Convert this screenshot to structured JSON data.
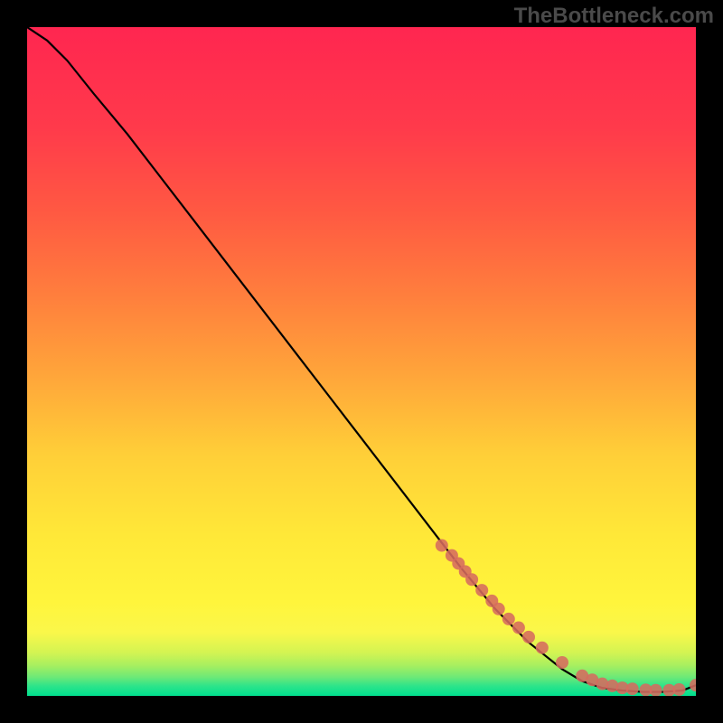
{
  "watermark": "TheBottleneck.com",
  "chart_data": {
    "type": "line",
    "title": "",
    "xlabel": "",
    "ylabel": "",
    "xlim": [
      0,
      100
    ],
    "ylim": [
      0,
      100
    ],
    "gradient_bands": [
      {
        "y_from": 0,
        "y_to": 2,
        "color": "#00e676"
      },
      {
        "y_from": 2,
        "y_to": 3.5,
        "color": "#4de686"
      },
      {
        "y_from": 3.5,
        "y_to": 5,
        "color": "#8bed6e"
      },
      {
        "y_from": 5,
        "y_to": 7,
        "color": "#c5f25a"
      },
      {
        "y_from": 7,
        "y_to": 12,
        "color": "#f5f542"
      },
      {
        "y_from": 12,
        "y_to": 25,
        "color": "#ffe838"
      },
      {
        "y_from": 25,
        "y_to": 40,
        "color": "#ffc93c"
      },
      {
        "y_from": 40,
        "y_to": 55,
        "color": "#ffa23c"
      },
      {
        "y_from": 55,
        "y_to": 70,
        "color": "#ff7b3c"
      },
      {
        "y_from": 70,
        "y_to": 85,
        "color": "#ff553f"
      },
      {
        "y_from": 85,
        "y_to": 100,
        "color": "#ff2e4d"
      }
    ],
    "series": [
      {
        "name": "curve",
        "type": "line",
        "color": "#000000",
        "x": [
          0,
          3,
          6,
          10,
          15,
          20,
          25,
          30,
          35,
          40,
          45,
          50,
          55,
          60,
          65,
          70,
          75,
          80,
          83,
          86,
          89,
          92,
          95,
          98,
          100
        ],
        "y": [
          100,
          98,
          95,
          90,
          84,
          77.5,
          71,
          64.5,
          58,
          51.5,
          45,
          38.5,
          32,
          25.5,
          19,
          13,
          8,
          4,
          2.2,
          1.2,
          0.8,
          0.6,
          0.6,
          0.8,
          1.6
        ]
      },
      {
        "name": "dots",
        "type": "scatter",
        "color": "#d66b5f",
        "x": [
          62,
          63.5,
          64.5,
          65.5,
          66.5,
          68,
          69.5,
          70.5,
          72,
          73.5,
          75,
          77,
          80,
          83,
          84.5,
          86,
          87.5,
          89,
          90.5,
          92.5,
          94,
          96,
          97.5,
          100
        ],
        "y": [
          22.5,
          21,
          19.8,
          18.6,
          17.4,
          15.8,
          14.2,
          13,
          11.5,
          10.2,
          8.8,
          7.2,
          5,
          3,
          2.4,
          1.8,
          1.5,
          1.2,
          1.05,
          0.9,
          0.85,
          0.85,
          0.95,
          1.6
        ]
      }
    ]
  }
}
